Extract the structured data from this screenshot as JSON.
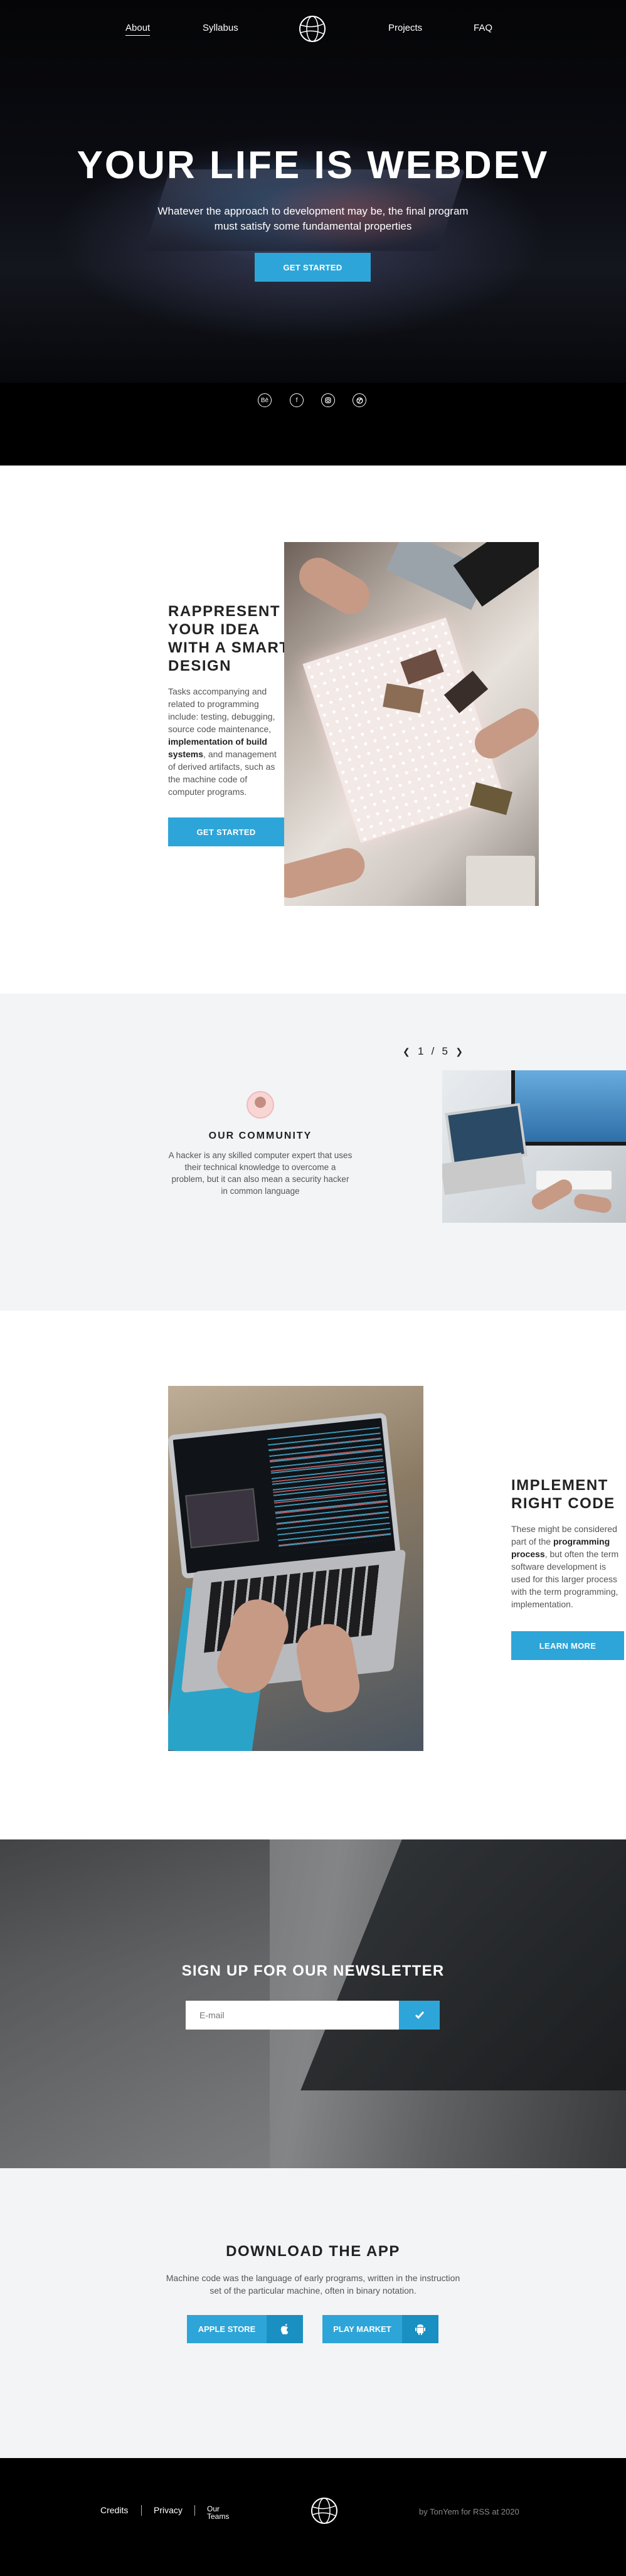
{
  "nav": {
    "about": "About",
    "syllabus": "Syllabus",
    "projects": "Projects",
    "faq": "FAQ"
  },
  "hero": {
    "title": "YOUR LIFE IS WEBDEV",
    "subtitle": "Whatever the approach to development may be, the final program must satisfy some fundamental properties",
    "cta": "GET STARTED",
    "social_icons": [
      "behance-icon",
      "facebook-icon",
      "instagram-icon",
      "dribbble-icon"
    ]
  },
  "feature1": {
    "title": "RAPPRESENT YOUR IDEA WITH A SMART DESIGN",
    "text_a": "Tasks accompanying and related to programming include: testing, debugging, source code maintenance, ",
    "text_bold": "implementation of build systems",
    "text_b": ", and management of derived artifacts, such as the machine code of computer programs.",
    "cta": "GET STARTED"
  },
  "community": {
    "pager_current": "1",
    "pager_sep": "/",
    "pager_total": "5",
    "title": "OUR COMMUNITY",
    "text": "A hacker is any skilled computer expert that uses their technical knowledge to overcome a problem, but it can also mean a security hacker in common language"
  },
  "feature2": {
    "title": "IMPLEMENT RIGHT CODE",
    "text_a": "These might be considered part of the ",
    "text_bold": "programming process",
    "text_b": ", but often the term software development is used for this larger process with the term programming, implementation.",
    "cta": "LEARN MORE"
  },
  "newsletter": {
    "title": "SIGN UP FOR OUR NEWSLETTER",
    "placeholder": "E-mail"
  },
  "app": {
    "title": "DOWNLOAD THE APP",
    "text": "Machine code was the language of early programs, written in the instruction set of the particular machine, often in binary notation.",
    "apple": "APPLE STORE",
    "play": "PLAY MARKET"
  },
  "footer": {
    "credits": "Credits",
    "privacy": "Privacy",
    "our": "Our",
    "teams": "Teams",
    "copyright": "by TonYem for RSS at 2020"
  },
  "colors": {
    "accent": "#2ea5d8",
    "dark": "#000000",
    "light_bg": "#f3f4f6"
  }
}
